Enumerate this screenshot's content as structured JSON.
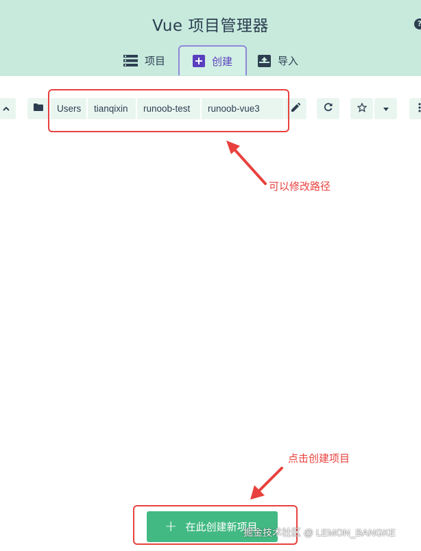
{
  "header": {
    "title": "Vue 项目管理器",
    "help_glyph": "?",
    "tabs": [
      {
        "label": "项目",
        "icon": "list-icon"
      },
      {
        "label": "创建",
        "icon": "add-box-icon",
        "active": true
      },
      {
        "label": "导入",
        "icon": "unarchive-icon"
      }
    ]
  },
  "path_bar": {
    "segments": [
      "Users",
      "tianqixin",
      "runoob-test",
      "runoob-vue3"
    ],
    "icons": {
      "parent": "chevron-up-icon",
      "folder": "folder-icon",
      "edit": "pencil-icon",
      "refresh": "refresh-icon",
      "favorite": "star-outline-icon",
      "favorites_menu": "caret-down-icon",
      "more": "more-vert-icon"
    }
  },
  "annotations": {
    "path_note": "可以修改路径",
    "create_note": "点击创建项目"
  },
  "create_button": {
    "label": "在此创建新项目",
    "glyph": "+"
  },
  "watermark": "掘金技术社区 @ LEMON_BANGKE",
  "colors": {
    "header_bg": "#c7eadd",
    "active_tab": "#5a3fbf",
    "primary": "#42b983",
    "annotation": "#e8413d",
    "text": "#2c3e50"
  }
}
